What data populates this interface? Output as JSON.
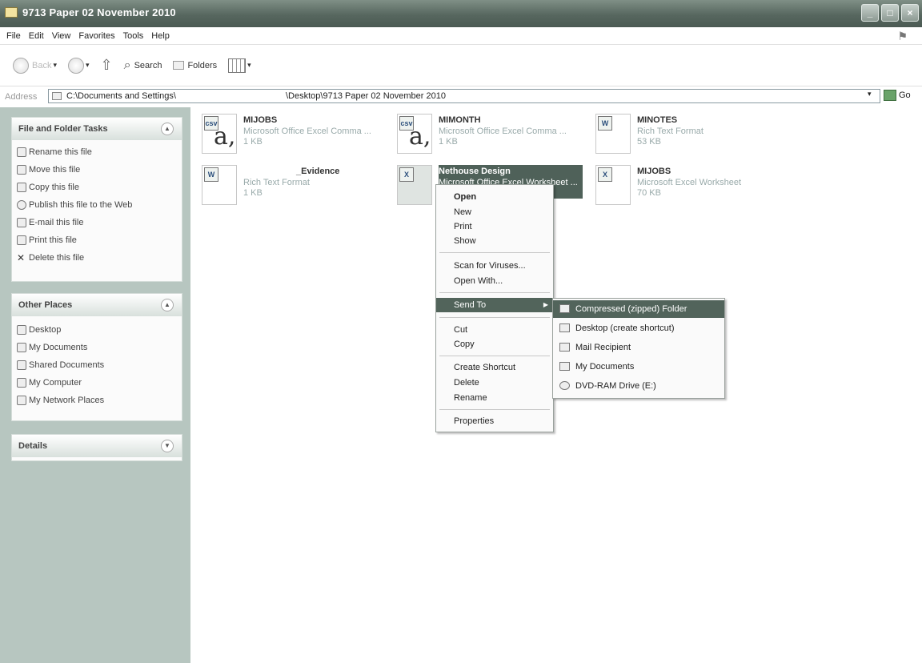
{
  "window": {
    "title": "9713 Paper 02 November 2010",
    "buttons": {
      "minimize": "_",
      "maximize": "□",
      "close": "×"
    }
  },
  "menubar": {
    "items": [
      "File",
      "Edit",
      "View",
      "Favorites",
      "Tools",
      "Help"
    ]
  },
  "toolbar": {
    "back_label": "Back",
    "search_label": "Search",
    "folders_label": "Folders"
  },
  "address": {
    "label": "Address",
    "path_part1": "C:\\Documents and Settings\\",
    "path_part2": "\\Desktop\\9713 Paper 02 November 2010",
    "go_label": "Go"
  },
  "left_pane": {
    "file_tasks": {
      "title": "File and Folder Tasks",
      "items": [
        "Rename this file",
        "Move this file",
        "Copy this file",
        "Publish this file to the Web",
        "E-mail this file",
        "Print this file",
        "Delete this file"
      ]
    },
    "other_places": {
      "title": "Other Places",
      "items": [
        "Desktop",
        "My Documents",
        "Shared Documents",
        "My Computer",
        "My Network Places"
      ]
    },
    "details": {
      "title": "Details"
    }
  },
  "files": [
    {
      "name": "MIJOBS",
      "type": "Microsoft Office Excel Comma ...",
      "size": "1 KB",
      "icon": "csv-file-icon"
    },
    {
      "name": "MIMONTH",
      "type": "Microsoft Office Excel Comma ...",
      "size": "1 KB",
      "icon": "csv-file-icon"
    },
    {
      "name": "MINOTES",
      "type": "Rich Text Format",
      "size": "53 KB",
      "icon": "rtf-file-icon"
    },
    {
      "name": "_Evidence",
      "type": "Rich Text Format",
      "size": "1 KB",
      "icon": "rtf-file-icon"
    },
    {
      "name": "Nethouse Design",
      "type": "Microsoft Office Excel Worksheet ...",
      "size": "",
      "icon": "excel-file-icon"
    },
    {
      "name": "MIJOBS",
      "type": "Microsoft Excel Worksheet",
      "size": "70 KB",
      "icon": "excel-file-icon"
    }
  ],
  "context_menu": {
    "items": [
      "Open",
      "New",
      "Print",
      "Show",
      "Scan for Viruses...",
      "Open With...",
      "Send To",
      "Cut",
      "Copy",
      "Create Shortcut",
      "Delete",
      "Rename",
      "Properties"
    ]
  },
  "send_to_menu": {
    "items": [
      "Compressed (zipped) Folder",
      "Desktop (create shortcut)",
      "Mail Recipient",
      "My Documents",
      "DVD-RAM Drive (E:)"
    ]
  },
  "colors": {
    "titlebar": "#57675f",
    "left_pane_bg": "#b7c6c0",
    "highlight": "#52645b"
  }
}
